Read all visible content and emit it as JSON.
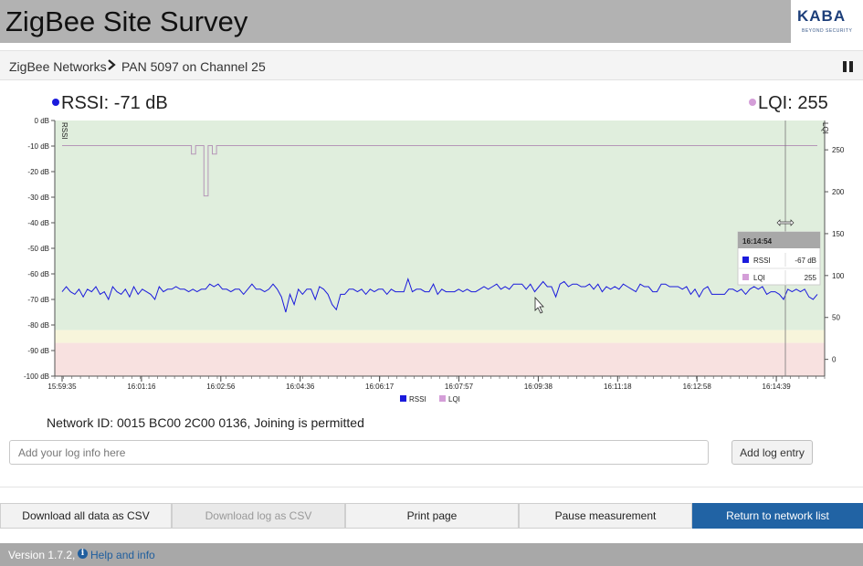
{
  "app": {
    "title": "ZigBee Site Survey"
  },
  "logo": {
    "brand": "KABA",
    "tagline": "BEYOND SECURITY",
    "color": "#1d3f7a"
  },
  "breadcrumb": {
    "root": "ZigBee Networks",
    "current": "PAN 5097 on Channel 25",
    "separator_icon": "chevron-right-icon",
    "pause_icon": "pause-icon"
  },
  "readouts": {
    "rssi": "RSSI: -71 dB",
    "lqi": "LQI: 255",
    "rssi_color": "#1a1adc",
    "lqi_color": "#d49ed8"
  },
  "tooltip": {
    "time": "16:14:54",
    "rows": [
      {
        "label": "RSSI",
        "value": "-67 dB"
      },
      {
        "label": "LQI",
        "value": "255"
      }
    ]
  },
  "chart_data": {
    "type": "line",
    "title": "",
    "left_axis_label": "RSSI",
    "right_axis_label": "LQI",
    "left_ylim": [
      -100,
      0
    ],
    "left_ticks": [
      "0 dB",
      "-10 dB",
      "-20 dB",
      "-30 dB",
      "-40 dB",
      "-50 dB",
      "-60 dB",
      "-70 dB",
      "-80 dB",
      "-90 dB",
      "-100 dB"
    ],
    "right_ylim": [
      -20,
      285
    ],
    "right_ticks": [
      "250",
      "200",
      "150",
      "100",
      "50",
      "0"
    ],
    "x_tick_labels": [
      "15:59:35",
      "16:01:16",
      "16:02:56",
      "16:04:36",
      "16:06:17",
      "16:07:57",
      "16:09:38",
      "16:11:18",
      "16:12:58",
      "16:14:39"
    ],
    "grid": false,
    "legend_position": "bottom-center",
    "bands": [
      {
        "from": -82,
        "to": 0,
        "color": "#e0eedd"
      },
      {
        "from": -87,
        "to": -82,
        "color": "#f7f5db"
      },
      {
        "from": -100,
        "to": -87,
        "color": "#f8e1e0"
      }
    ],
    "crosshair_time": "16:14:54",
    "series": [
      {
        "name": "RSSI",
        "color": "#1a1adc",
        "values": [
          -67,
          -65,
          -67,
          -68,
          -66,
          -69,
          -66,
          -67,
          -65,
          -68,
          -67,
          -70,
          -65,
          -67,
          -68,
          -66,
          -69,
          -65,
          -68,
          -66,
          -67,
          -68,
          -70,
          -65,
          -67,
          -66,
          -66,
          -65,
          -66,
          -66,
          -67,
          -66,
          -67,
          -66,
          -66,
          -64,
          -65,
          -64,
          -66,
          -66,
          -67,
          -66,
          -66,
          -68,
          -66,
          -64,
          -66,
          -66,
          -67,
          -66,
          -64,
          -66,
          -69,
          -75,
          -68,
          -72,
          -66,
          -68,
          -66,
          -66,
          -70,
          -65,
          -66,
          -68,
          -72,
          -74,
          -68,
          -68,
          -66,
          -66,
          -67,
          -66,
          -68,
          -66,
          -67,
          -66,
          -66,
          -68,
          -66,
          -67,
          -67,
          -67,
          -62,
          -67,
          -66,
          -66,
          -67,
          -67,
          -64,
          -68,
          -66,
          -67,
          -67,
          -67,
          -66,
          -67,
          -66,
          -67,
          -67,
          -66,
          -65,
          -66,
          -65,
          -64,
          -66,
          -65,
          -66,
          -64,
          -64,
          -64,
          -66,
          -64,
          -67,
          -65,
          -63,
          -65,
          -65,
          -69,
          -64,
          -63,
          -65,
          -64,
          -64,
          -65,
          -65,
          -64,
          -66,
          -64,
          -67,
          -65,
          -66,
          -65,
          -66,
          -64,
          -65,
          -66,
          -67,
          -64,
          -65,
          -65,
          -67,
          -67,
          -64,
          -64,
          -65,
          -65,
          -65,
          -66,
          -65,
          -68,
          -66,
          -69,
          -66,
          -65,
          -68,
          -68,
          -68,
          -68,
          -66,
          -66,
          -67,
          -66,
          -68,
          -66,
          -65,
          -66,
          -65,
          -68,
          -67,
          -67,
          -68,
          -70,
          -66,
          -67,
          -66,
          -67,
          -66,
          -69,
          -70,
          -68
        ]
      },
      {
        "name": "LQI",
        "color": "#b596b8",
        "values": [
          255,
          255,
          255,
          255,
          255,
          255,
          255,
          255,
          255,
          255,
          255,
          255,
          255,
          255,
          255,
          255,
          255,
          255,
          255,
          255,
          255,
          255,
          255,
          255,
          255,
          255,
          255,
          255,
          255,
          255,
          255,
          245,
          255,
          255,
          195,
          255,
          245,
          255,
          255,
          255,
          255,
          255,
          255,
          255,
          255,
          255,
          255,
          255,
          255,
          255,
          255,
          255,
          255,
          255,
          255,
          255,
          255,
          255,
          255,
          255,
          255,
          255,
          255,
          255,
          255,
          255,
          255,
          255,
          255,
          255,
          255,
          255,
          255,
          255,
          255,
          255,
          255,
          255,
          255,
          255,
          255,
          255,
          255,
          255,
          255,
          255,
          255,
          255,
          255,
          255,
          255,
          255,
          255,
          255,
          255,
          255,
          255,
          255,
          255,
          255,
          255,
          255,
          255,
          255,
          255,
          255,
          255,
          255,
          255,
          255,
          255,
          255,
          255,
          255,
          255,
          255,
          255,
          255,
          255,
          255,
          255,
          255,
          255,
          255,
          255,
          255,
          255,
          255,
          255,
          255,
          255,
          255,
          255,
          255,
          255,
          255,
          255,
          255,
          255,
          255,
          255,
          255,
          255,
          255,
          255,
          255,
          255,
          255,
          255,
          255,
          255,
          255,
          255,
          255,
          255,
          255,
          255,
          255,
          255,
          255,
          255,
          255,
          255,
          255,
          255,
          255,
          255,
          255,
          255,
          255,
          255,
          255,
          255,
          255,
          255,
          255,
          255,
          255,
          255,
          255,
          255,
          255
        ]
      }
    ]
  },
  "status": {
    "network_id": "Network ID: 0015 BC00 2C00 0136, Joining is permitted"
  },
  "log": {
    "placeholder": "Add your log info here",
    "add_button": "Add log entry"
  },
  "actions": {
    "download_all": "Download all data as CSV",
    "download_log": "Download log as CSV",
    "print": "Print page",
    "pause": "Pause measurement",
    "return": "Return to network list",
    "primary_color": "#2163a4"
  },
  "footer": {
    "version": "Version 1.7.2,",
    "help": "Help and info",
    "help_icon": "info-icon"
  }
}
